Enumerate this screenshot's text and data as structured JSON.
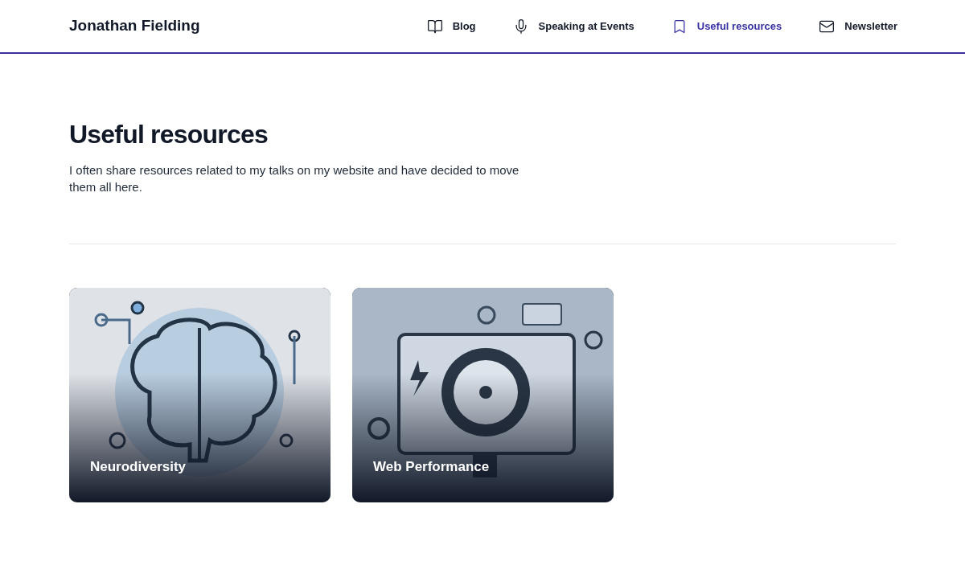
{
  "site_title": "Jonathan Fielding",
  "nav": [
    {
      "label": "Blog",
      "selected": false
    },
    {
      "label": "Speaking at Events",
      "selected": false
    },
    {
      "label": "Useful resources",
      "selected": true
    },
    {
      "label": "Newsletter",
      "selected": false
    }
  ],
  "page": {
    "heading": "Useful resources",
    "intro": "I often share resources related to my talks on my website and have decided to move them all here."
  },
  "cards": [
    {
      "title": "Neurodiversity",
      "kind": "picture"
    },
    {
      "title": "Web Performance",
      "kind": "picture"
    }
  ]
}
